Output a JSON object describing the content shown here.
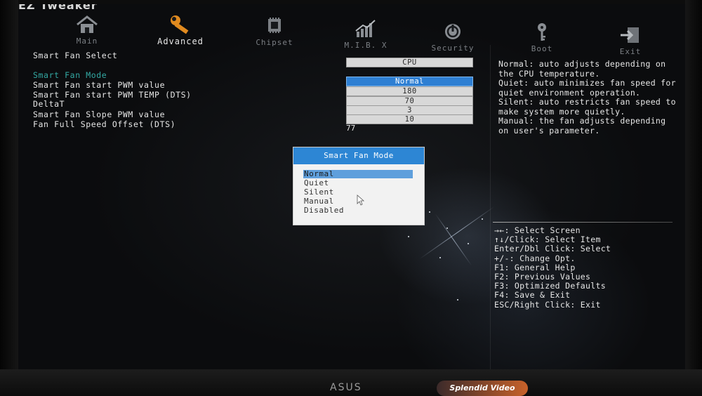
{
  "brand": "EZ Tweaker",
  "tabs": [
    {
      "label": "Main",
      "icon": "home-icon",
      "active": false
    },
    {
      "label": "Advanced",
      "icon": "wrench-icon",
      "active": true
    },
    {
      "label": "Chipset",
      "icon": "chip-icon",
      "active": false
    },
    {
      "label": "M.I.B. X",
      "icon": "bar-chart-icon",
      "active": false
    },
    {
      "label": "Security",
      "icon": "power-icon",
      "active": false
    },
    {
      "label": "Boot",
      "icon": "key-icon",
      "active": false
    },
    {
      "label": "Exit",
      "icon": "exit-icon",
      "active": false
    }
  ],
  "section_title": "Smart Fan Select",
  "column_header": "CPU",
  "settings": [
    {
      "label": "Smart Fan Mode",
      "value": "Normal"
    },
    {
      "label": "Smart Fan start PWM value",
      "value": "180"
    },
    {
      "label": "Smart Fan start PWM TEMP (DTS)",
      "value": "70"
    },
    {
      "label": "DeltaT",
      "value": "3"
    },
    {
      "label": "Smart Fan Slope PWM value",
      "value": "10"
    },
    {
      "label": "Fan Full Speed Offset (DTS)",
      "value": "77"
    }
  ],
  "help_text": [
    "Normal: auto adjusts depending on",
    "the CPU temperature.",
    "Quiet: auto minimizes fan speed for",
    "quiet environment operation.",
    "Silent: auto restricts fan speed to",
    "make system more quietly.",
    "Manual: the fan adjusts depending",
    "on user's parameter."
  ],
  "key_help": [
    "→←: Select Screen",
    "↑↓/Click: Select Item",
    "Enter/Dbl Click: Select",
    "+/-: Change Opt.",
    "F1: General Help",
    "F2: Previous Values",
    "F3: Optimized Defaults",
    "F4: Save & Exit",
    "ESC/Right Click: Exit"
  ],
  "popup": {
    "title": "Smart Fan Mode",
    "options": [
      "Normal",
      "Quiet",
      "Silent",
      "Manual",
      "Disabled"
    ],
    "selected_index": 0
  },
  "monitor": {
    "logo": "ASUS",
    "badge": "Splendid Video"
  },
  "colors": {
    "accent": "#2d86d4",
    "highlight_label": "#33a9a3",
    "text": "#e6e6e6"
  }
}
